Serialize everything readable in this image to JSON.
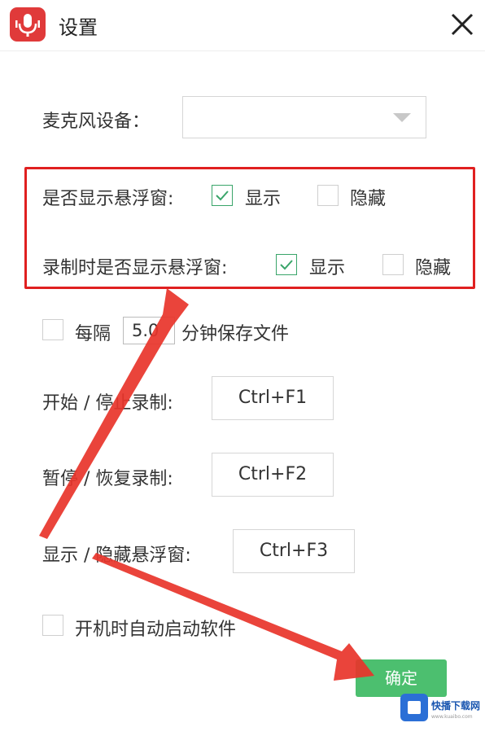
{
  "window": {
    "title": "设置",
    "close_icon": "close-icon",
    "app_icon": "microphone-app-icon"
  },
  "mic": {
    "label": "麦克风设备：",
    "value": ""
  },
  "float_window": {
    "label": "是否显示悬浮窗:",
    "show_label": "显示",
    "show_checked": true,
    "hide_label": "隐藏",
    "hide_checked": false
  },
  "record_float_window": {
    "label": "录制时是否显示悬浮窗:",
    "show_label": "显示",
    "show_checked": true,
    "hide_label": "隐藏",
    "hide_checked": false
  },
  "autosave": {
    "checked": false,
    "prefix": "每隔",
    "value": "5.0",
    "suffix": "分钟保存文件"
  },
  "hotkeys": {
    "start_stop": {
      "label": "开始 / 停止录制:",
      "value": "Ctrl+F1"
    },
    "pause_resume": {
      "label": "暂停 / 恢复录制:",
      "value": "Ctrl+F2"
    },
    "show_hide_float": {
      "label": "显示 / 隐藏悬浮窗:",
      "value": "Ctrl+F3"
    }
  },
  "autostart": {
    "checked": false,
    "label": "开机时自动启动软件"
  },
  "confirm_button": "确定",
  "watermark": {
    "text": "快播下载网",
    "sub": "www.kuaibo.com"
  },
  "colors": {
    "accent_green": "#4cbf6f",
    "check_green": "#3aa56a",
    "highlight_red": "#e02020"
  }
}
